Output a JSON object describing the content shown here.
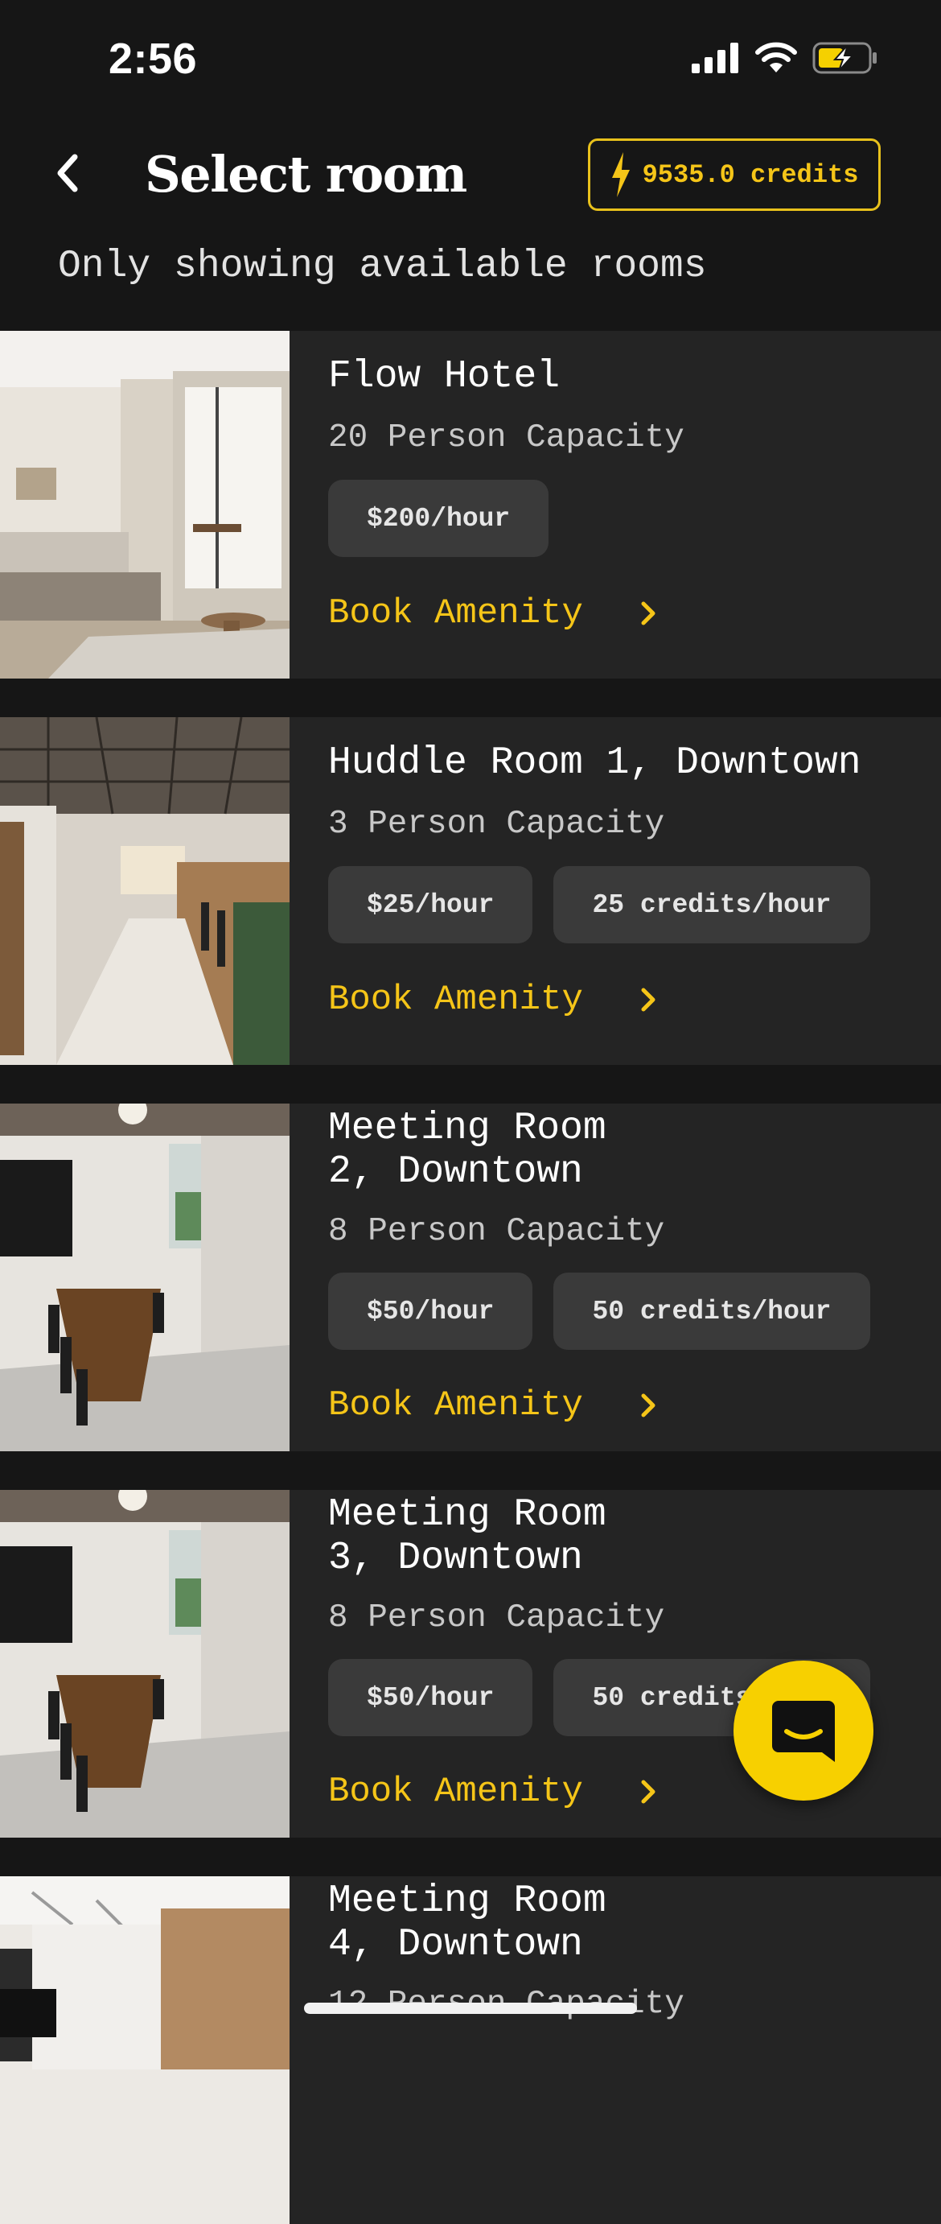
{
  "status_bar": {
    "time": "2:56",
    "icons": [
      "signal-icon",
      "wifi-icon",
      "battery-charging-icon"
    ]
  },
  "header": {
    "title": "Select room",
    "back_icon": "chevron-left-icon",
    "credits_label": "9535.0 credits",
    "credits_icon": "lightning-icon"
  },
  "subtitle": "Only showing available rooms",
  "colors": {
    "accent": "#f5c518",
    "background": "#161616",
    "card": "#242424",
    "chip": "#3a3a3a"
  },
  "rooms": [
    {
      "name": "Flow Hotel",
      "capacity": "20 Person Capacity",
      "price": "$200/hour",
      "credits": "",
      "book_label": "Book Amenity"
    },
    {
      "name": "Huddle Room 1, Downtown",
      "capacity": "3 Person Capacity",
      "price": "$25/hour",
      "credits": "25 credits/hour",
      "book_label": "Book Amenity"
    },
    {
      "name": "Meeting Room\n2, Downtown",
      "capacity": "8 Person Capacity",
      "price": "$50/hour",
      "credits": "50 credits/hour",
      "book_label": "Book Amenity"
    },
    {
      "name": "Meeting Room\n3, Downtown",
      "capacity": "8 Person Capacity",
      "price": "$50/hour",
      "credits": "50 credits/hour",
      "book_label": "Book Amenity"
    },
    {
      "name": "Meeting Room\n4, Downtown",
      "capacity": "12 Person Capacity",
      "price": "",
      "credits": "",
      "book_label": ""
    }
  ],
  "fab": {
    "icon": "chat-icon"
  }
}
